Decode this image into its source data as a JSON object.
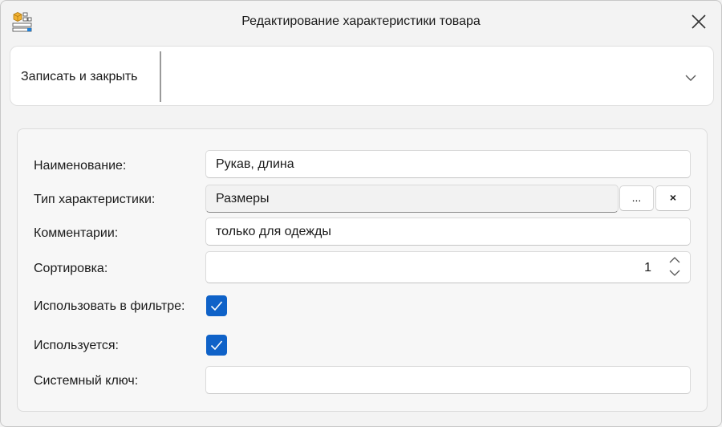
{
  "window": {
    "title": "Редактирование характеристики товара",
    "app_icon": "boxes-icon",
    "close_icon": "close-icon"
  },
  "toolbar": {
    "save_close_label": "Записать и закрыть",
    "more_icon": "chevron-down-icon"
  },
  "form": {
    "name_label": "Наименование:",
    "name_value": "Рукав, длина",
    "type_label": "Тип характеристики:",
    "type_value": "Размеры",
    "type_select_label": "...",
    "type_clear_label": "×",
    "comment_label": "Комментарии:",
    "comment_value": "только для одежды",
    "sort_label": "Сортировка:",
    "sort_value": "1",
    "filter_label": "Использовать в фильтре:",
    "filter_checked": true,
    "used_label": "Используется:",
    "used_checked": true,
    "syskey_label": "Системный ключ:",
    "syskey_value": ""
  },
  "colors": {
    "accent": "#0f62c8"
  }
}
